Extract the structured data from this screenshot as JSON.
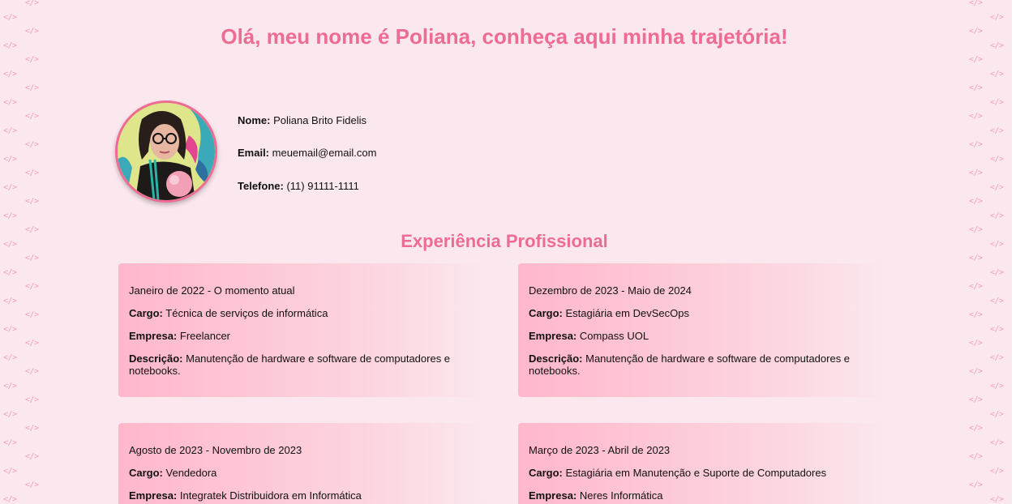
{
  "decor": {
    "glyph": "</>"
  },
  "header": {
    "title": "Olá, meu nome é Poliana, conheça aqui minha trajetória!"
  },
  "profile": {
    "name_label": "Nome:",
    "name": "Poliana Brito Fidelis",
    "email_label": "Email:",
    "email": "meuemail@email.com",
    "phone_label": "Telefone:",
    "phone": "(11) 91111-1111"
  },
  "experience": {
    "title": "Experiência Profissional",
    "labels": {
      "cargo": "Cargo:",
      "empresa": "Empresa:",
      "descricao": "Descrição:"
    },
    "items": [
      {
        "period": "Janeiro de 2022 - O momento atual",
        "cargo": "Técnica de serviços de informática",
        "empresa": "Freelancer",
        "descricao": "Manutenção de hardware e software de computadores e notebooks."
      },
      {
        "period": "Dezembro de 2023 - Maio de 2024",
        "cargo": "Estagiária em DevSecOps",
        "empresa": "Compass UOL",
        "descricao": "Manutenção de hardware e software de computadores e notebooks."
      },
      {
        "period": "Agosto de 2023 - Novembro de 2023",
        "cargo": "Vendedora",
        "empresa": "Integratek Distribuidora em Informática",
        "descricao": ""
      },
      {
        "period": "Março de 2023 - Abril de 2023",
        "cargo": "Estagiária em Manutenção e Suporte de Computadores",
        "empresa": "Neres Informática",
        "descricao": ""
      }
    ]
  },
  "colors": {
    "accent": "#ee6b93",
    "background": "#fbe8ee",
    "card_start": "#ffb7cb",
    "decor": "#f2a1b8"
  }
}
